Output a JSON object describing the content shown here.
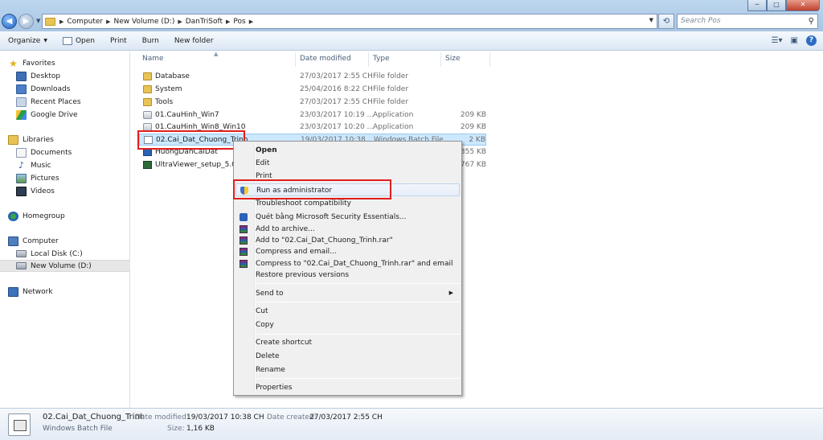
{
  "window": {
    "controls": {
      "minimize": "─",
      "maximize": "□",
      "close": "✕"
    }
  },
  "address": {
    "crumbs": [
      "Computer",
      "New Volume (D:)",
      "DanTriSoft",
      "Pos"
    ],
    "search_placeholder": "Search Pos"
  },
  "toolbar": {
    "organize": "Organize",
    "open": "Open",
    "print": "Print",
    "burn": "Burn",
    "new_folder": "New folder"
  },
  "nav": {
    "favorites": "Favorites",
    "desktop": "Desktop",
    "downloads": "Downloads",
    "recent_places": "Recent Places",
    "google_drive": "Google Drive",
    "libraries": "Libraries",
    "documents": "Documents",
    "music": "Music",
    "pictures": "Pictures",
    "videos": "Videos",
    "homegroup": "Homegroup",
    "computer": "Computer",
    "local_disk": "Local Disk (C:)",
    "new_volume": "New Volume (D:)",
    "network": "Network"
  },
  "columns": {
    "name": "Name",
    "date": "Date modified",
    "type": "Type",
    "size": "Size"
  },
  "files": [
    {
      "name": "Database",
      "date": "27/03/2017 2:55 CH",
      "type": "File folder",
      "size": ""
    },
    {
      "name": "System",
      "date": "25/04/2016 8:22 CH",
      "type": "File folder",
      "size": ""
    },
    {
      "name": "Tools",
      "date": "27/03/2017 2:55 CH",
      "type": "File folder",
      "size": ""
    },
    {
      "name": "01.CauHinh_Win7",
      "date": "23/03/2017 10:19 ...",
      "type": "Application",
      "size": "209 KB"
    },
    {
      "name": "01.CauHinh_Win8_Win10",
      "date": "23/03/2017 10:20 ...",
      "type": "Application",
      "size": "209 KB"
    },
    {
      "name": "02.Cai_Dat_Chuong_Trinh",
      "date": "19/03/2017 10:38",
      "type": "Windows Batch File",
      "size": "2 KB"
    },
    {
      "name": "HuongDanCaiDat",
      "date": "",
      "type": "",
      "size": "355 KB"
    },
    {
      "name": "UltraViewer_setup_5.0_vi",
      "date": "",
      "type": "",
      "size": "767 KB"
    }
  ],
  "context_menu": {
    "open": "Open",
    "edit": "Edit",
    "print": "Print",
    "run_as_admin": "Run as administrator",
    "troubleshoot": "Troubleshoot compatibility",
    "scan_mse": "Quét bằng Microsoft Security Essentials...",
    "add_archive": "Add to archive...",
    "add_rar": "Add to \"02.Cai_Dat_Chuong_Trinh.rar\"",
    "compress_email": "Compress and email...",
    "compress_rar_email": "Compress to \"02.Cai_Dat_Chuong_Trinh.rar\" and email",
    "restore": "Restore previous versions",
    "send_to": "Send to",
    "cut": "Cut",
    "copy": "Copy",
    "create_shortcut": "Create shortcut",
    "delete": "Delete",
    "rename": "Rename",
    "properties": "Properties"
  },
  "details": {
    "name": "02.Cai_Dat_Chuong_Trinh",
    "type": "Windows Batch File",
    "modified_label": "Date modified:",
    "modified": "19/03/2017 10:38 CH",
    "created_label": "Date created:",
    "created": "27/03/2017 2:55 CH",
    "size_label": "Size:",
    "size": "1,16 KB"
  }
}
